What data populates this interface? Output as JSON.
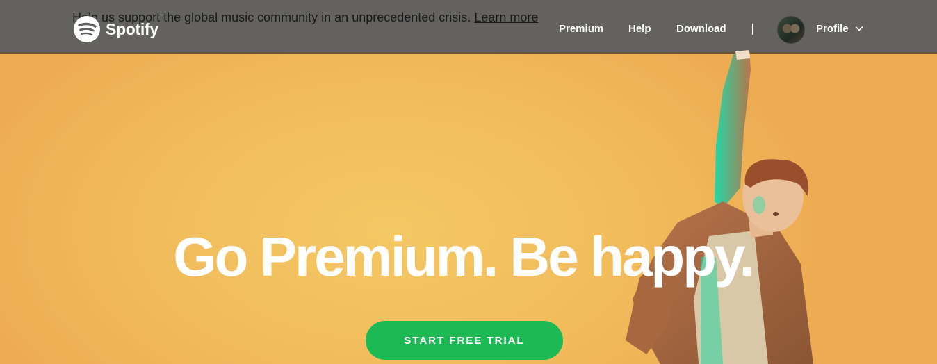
{
  "banner": {
    "text": "Help us support the global music community in an unprecedented crisis.",
    "link": "Learn more"
  },
  "header": {
    "brand": "Spotify",
    "logo_icon": "spotify-logo-icon",
    "nav": [
      "Premium",
      "Help",
      "Download"
    ],
    "profile_label": "Profile",
    "profile_icon": "chevron-down-icon",
    "avatar_icon": "avatar"
  },
  "hero": {
    "headline": "Go Premium. Be happy.",
    "cta": "START FREE TRIAL",
    "colors": {
      "background": "#f0b860",
      "cta": "#1db954"
    }
  }
}
